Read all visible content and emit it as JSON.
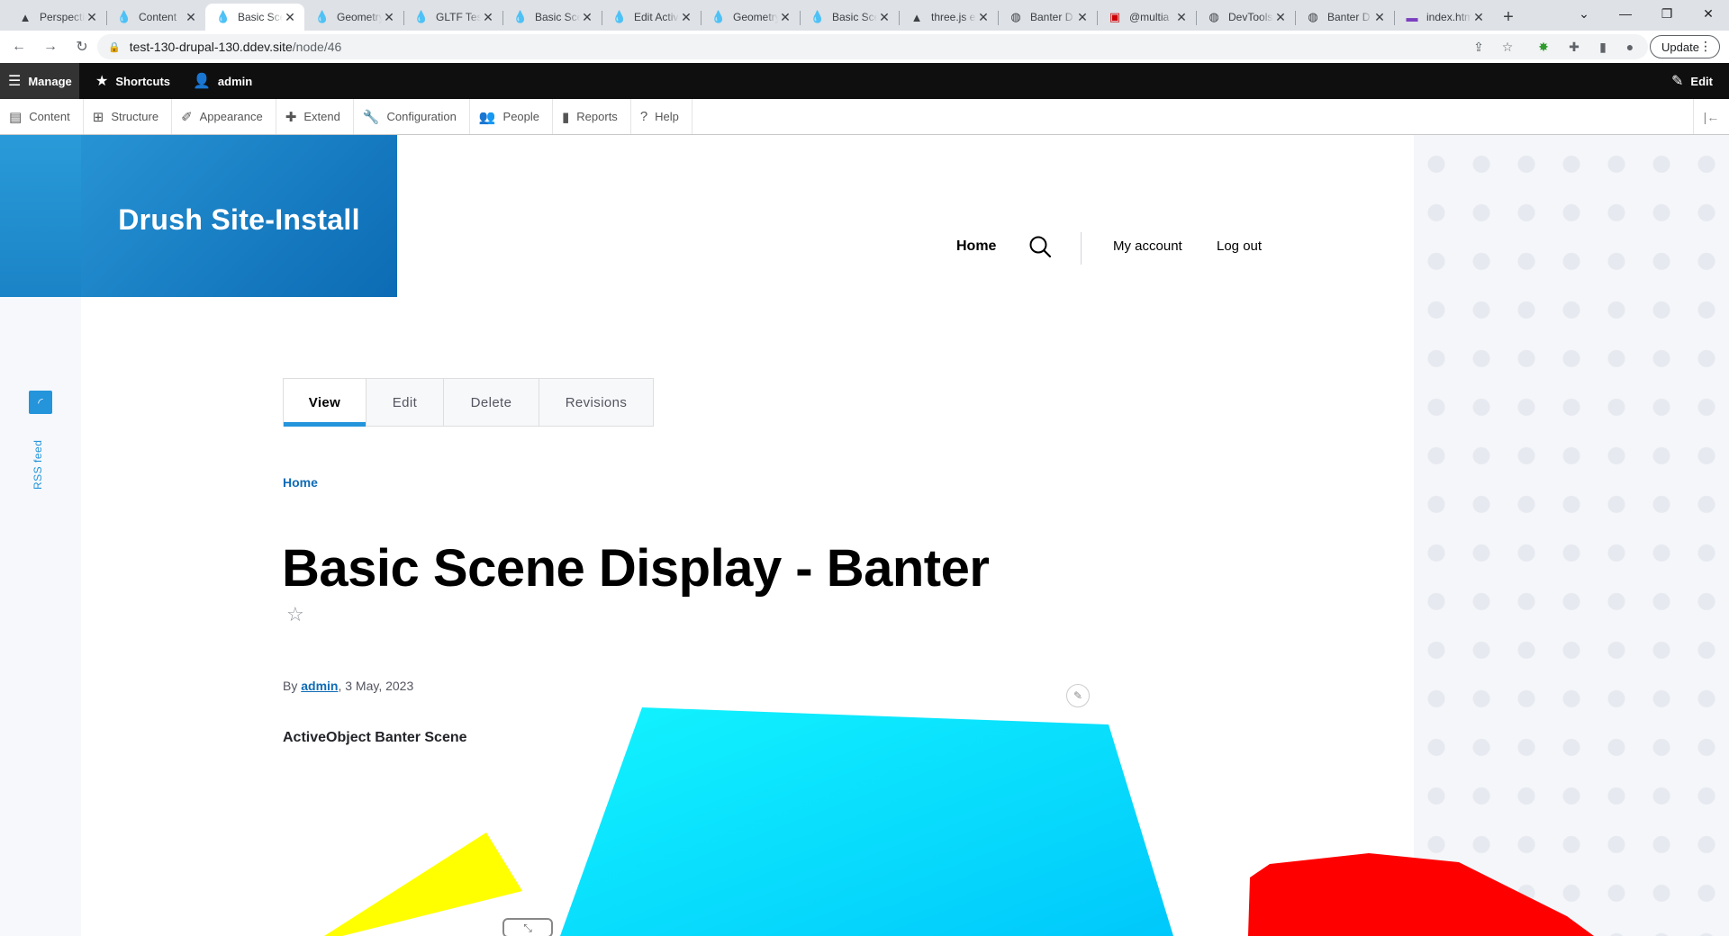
{
  "browser": {
    "tabs": [
      {
        "title": "Perspective",
        "icon": "threejs-icon",
        "active": false
      },
      {
        "title": "Content",
        "icon": "drupal-icon",
        "active": false
      },
      {
        "title": "Basic Scene",
        "icon": "drupal-icon",
        "active": true
      },
      {
        "title": "Geometry",
        "icon": "drupal-icon",
        "active": false
      },
      {
        "title": "GLTF Test",
        "icon": "drupal-icon",
        "active": false
      },
      {
        "title": "Basic Scene",
        "icon": "drupal-icon",
        "active": false
      },
      {
        "title": "Edit Active",
        "icon": "drupal-icon",
        "active": false
      },
      {
        "title": "Geometry",
        "icon": "drupal-icon",
        "active": false
      },
      {
        "title": "Basic Scene",
        "icon": "drupal-icon",
        "active": false
      },
      {
        "title": "three.js e",
        "icon": "threejs-icon",
        "active": false
      },
      {
        "title": "Banter D",
        "icon": "globe-icon",
        "active": false
      },
      {
        "title": "@multia",
        "icon": "bookmark-icon",
        "active": false
      },
      {
        "title": "DevTools",
        "icon": "globe-icon",
        "active": false
      },
      {
        "title": "Banter D",
        "icon": "globe-icon",
        "active": false
      },
      {
        "title": "index.htm",
        "icon": "flag-icon",
        "active": false
      }
    ],
    "url_host": "test-130-drupal-130.ddev.site",
    "url_path": "/node/46",
    "update_label": "Update"
  },
  "admin": {
    "manage": "Manage",
    "shortcuts": "Shortcuts",
    "user": "admin",
    "edit": "Edit",
    "tray": [
      "Content",
      "Structure",
      "Appearance",
      "Extend",
      "Configuration",
      "People",
      "Reports",
      "Help"
    ]
  },
  "site": {
    "name": "Drush Site-Install",
    "nav_home": "Home",
    "nav_account": "My account",
    "nav_logout": "Log out",
    "rss_label": "RSS feed"
  },
  "node": {
    "tabs": [
      "View",
      "Edit",
      "Delete",
      "Revisions"
    ],
    "active_tab": "View",
    "breadcrumb": "Home",
    "title": "Basic Scene Display - Banter",
    "by_prefix": "By ",
    "author": "admin",
    "date": ", 3 May, 2023",
    "body": "ActiveObject Banter Scene"
  },
  "colors": {
    "brand_blue": "#2494db",
    "link_blue": "#0f6cb6",
    "scene_cyan": "#00d8ff",
    "scene_yellow": "#ffff00",
    "scene_red": "#ff0000"
  }
}
